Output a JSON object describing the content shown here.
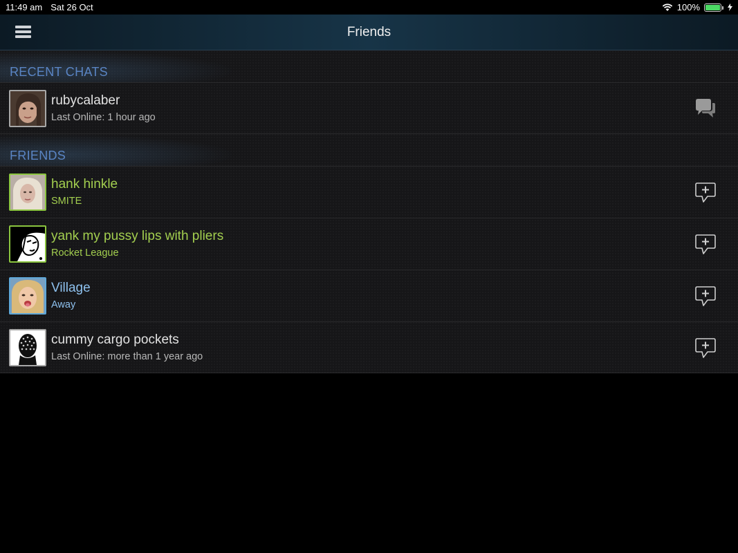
{
  "status_bar": {
    "time": "11:49 am",
    "date": "Sat 26 Oct",
    "battery": "100%",
    "battery_level": 1.0
  },
  "nav": {
    "title": "Friends",
    "menu_icon": "hamburger-icon"
  },
  "recent_chats": {
    "header": "RECENT CHATS",
    "items": [
      {
        "name": "rubycalaber",
        "status": "Last Online: 1 hour ago",
        "state": "offline",
        "action_icon": "chat-bubbles-icon"
      }
    ]
  },
  "friends": {
    "header": "FRIENDS",
    "items": [
      {
        "name": "hank hinkle",
        "status": "SMITE",
        "state": "ingame",
        "action_icon": "new-chat-icon"
      },
      {
        "name": "yank my pussy lips with pliers",
        "status": "Rocket League",
        "state": "ingame",
        "action_icon": "new-chat-icon"
      },
      {
        "name": "Village",
        "status": "Away",
        "state": "online",
        "action_icon": "new-chat-icon"
      },
      {
        "name": "cummy cargo pockets",
        "status": "Last Online: more than 1 year ago",
        "state": "offline",
        "action_icon": "new-chat-icon"
      }
    ]
  },
  "colors": {
    "ingame": "#a3cf4f",
    "online": "#8ec1ee",
    "offline": "#e2e2e2",
    "section_header": "#5a85c4"
  }
}
